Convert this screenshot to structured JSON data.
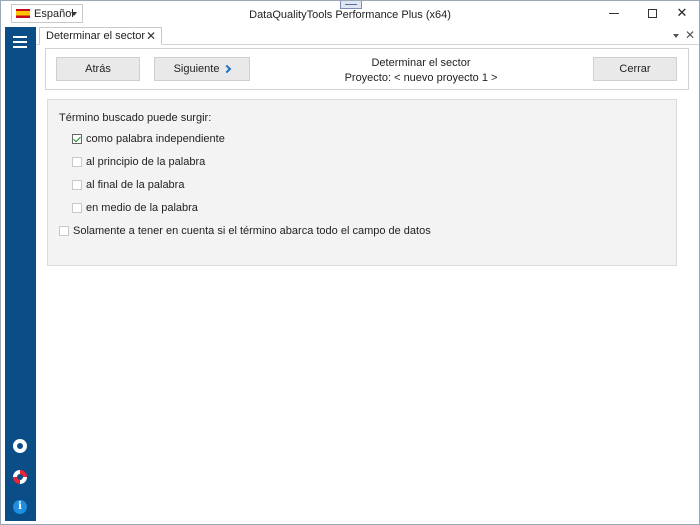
{
  "window": {
    "title": "DataQualityTools Performance Plus (x64)",
    "language": "Español"
  },
  "tabs": [
    {
      "label": "Determinar el sector",
      "active": true
    }
  ],
  "toolbar": {
    "back_label": "Atrás",
    "next_label": "Siguiente",
    "cancel_label": "Cerrar",
    "title": "Determinar el sector",
    "project": "Proyecto: < nuevo proyecto 1 >"
  },
  "panel": {
    "heading": "Término buscado puede surgir:",
    "options": [
      {
        "label": "como palabra independiente",
        "checked": true
      },
      {
        "label": "al principio de la palabra",
        "checked": false
      },
      {
        "label": "al final de la palabra",
        "checked": false
      },
      {
        "label": "en medio de la palabra",
        "checked": false
      }
    ],
    "whole_field": {
      "label": "Solamente a tener en cuenta si el término abarca todo el campo de datos",
      "checked": false
    }
  },
  "colors": {
    "sidebar": "#0b4d86",
    "accent": "#1f6fbf",
    "check": "#1a8f2a"
  },
  "icons": [
    "menu-icon",
    "gear-icon",
    "lifebuoy-icon",
    "info-icon"
  ]
}
